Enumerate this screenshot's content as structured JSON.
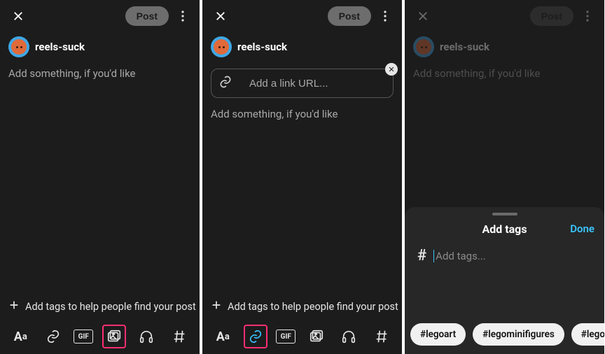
{
  "common": {
    "post_label": "Post",
    "username": "reels-suck",
    "compose_placeholder": "Add something, if you'd like",
    "add_tags_hint": "Add tags to help people find your post",
    "toolbar": {
      "text": "Aa",
      "gif": "GIF"
    }
  },
  "screen2": {
    "link_placeholder": "Add a link URL..."
  },
  "screen3": {
    "sheet_title": "Add tags",
    "done_label": "Done",
    "tag_input_placeholder": "Add tags...",
    "suggestions": [
      "#legoart",
      "#legominifigures",
      "#lego"
    ]
  }
}
